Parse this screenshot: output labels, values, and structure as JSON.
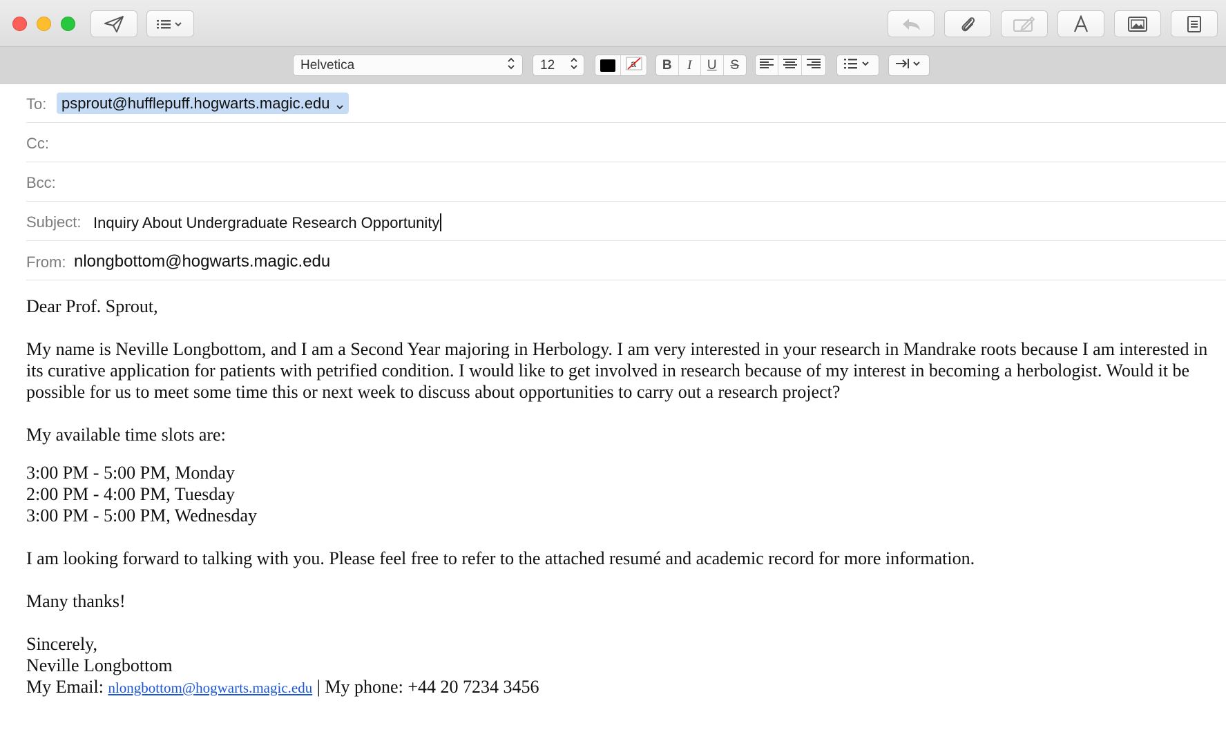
{
  "toolbar": {
    "send_icon": "paper-plane-icon",
    "header_fields_icon": "list-chevron-icon",
    "reply_icon": "reply-arrow-icon",
    "attach_icon": "paperclip-icon",
    "markup_icon": "markup-pen-icon",
    "format_icon": "font-a-icon",
    "photo_icon": "photo-browser-icon",
    "stationery_icon": "stationery-icon"
  },
  "format_bar": {
    "font": "Helvetica",
    "size": "12",
    "text_color": "#000000",
    "bold": "B",
    "italic": "I",
    "underline": "U",
    "strike": "S"
  },
  "header": {
    "to_label": "To:",
    "to_value": "psprout@hufflepuff.hogwarts.magic.edu",
    "cc_label": "Cc:",
    "bcc_label": "Bcc:",
    "subject_label": "Subject:",
    "subject_value": "Inquiry About Undergraduate Research Opportunity",
    "from_label": "From:",
    "from_value": "nlongbottom@hogwarts.magic.edu"
  },
  "body": {
    "greeting": "Dear Prof. Sprout,",
    "paragraph1": "My name is Neville Longbottom, and I am a Second Year majoring in Herbology. I am very interested in your research in Mandrake roots because I am interested in its curative application for patients with petrified condition. I would like to get involved in research because of my interest in becoming a herbologist. Would it be possible for us to meet some time this or next week to discuss about opportunities to carry out a research project?",
    "slots_intro": "My available time slots are:",
    "slots": [
      "3:00 PM - 5:00 PM, Monday",
      "2:00 PM - 4:00 PM, Tuesday",
      "3:00 PM - 5:00 PM, Wednesday"
    ],
    "paragraph2": "I am looking forward to talking with you. Please feel free to refer to the attached resumé and academic record for more information.",
    "thanks": "Many thanks!",
    "signoff": "Sincerely,",
    "name": "Neville Longbottom",
    "email_prefix": "My Email: ",
    "email_link": "nlongbottom@hogwarts.magic.edu",
    "phone_text": " | My phone: +44 20 7234 3456"
  }
}
